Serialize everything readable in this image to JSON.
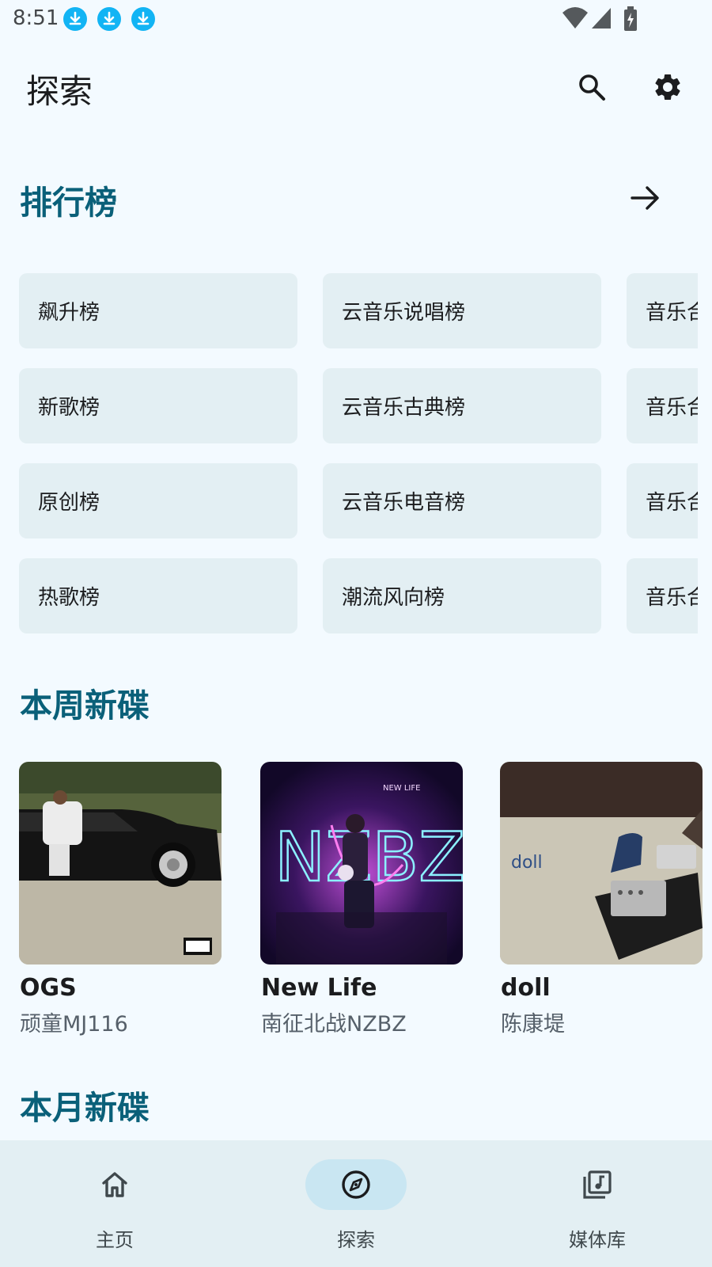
{
  "status_bar": {
    "time": "8:51"
  },
  "app_bar": {
    "title": "探索"
  },
  "sections": {
    "charts": {
      "title": "排行榜"
    },
    "weekly": {
      "title": "本周新碟"
    },
    "monthly": {
      "title": "本月新碟"
    }
  },
  "charts": [
    [
      "飙升榜",
      "新歌榜",
      "原创榜",
      "热歌榜"
    ],
    [
      "云音乐说唱榜",
      "云音乐古典榜",
      "云音乐电音榜",
      "潮流风向榜"
    ],
    [
      "音乐合",
      "音乐合",
      "音乐合",
      "音乐合"
    ]
  ],
  "weekly_albums": [
    {
      "title": "OGS",
      "artist": "顽童MJ116"
    },
    {
      "title": "New Life",
      "artist": "南征北战NZBZ"
    },
    {
      "title": "doll",
      "artist": "陈康堤"
    }
  ],
  "album_cover_text": {
    "nzbz_small": "NEW LIFE",
    "nzbz_big": "NZBZ",
    "doll": "doll"
  },
  "bottom_nav": [
    {
      "label": "主页",
      "icon": "home-icon"
    },
    {
      "label": "探索",
      "icon": "explore-icon"
    },
    {
      "label": "媒体库",
      "icon": "library-music-icon"
    }
  ],
  "colors": {
    "background": "#f3faff",
    "accent": "#0a6079",
    "chip": "#e3eff3",
    "nav_indicator": "#c9e6f2",
    "download_badge": "#12b4f4"
  }
}
